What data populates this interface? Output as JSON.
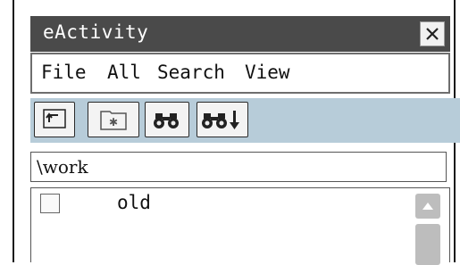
{
  "window": {
    "title": "eActivity"
  },
  "menu": {
    "items": [
      {
        "label": "File"
      },
      {
        "label": "All"
      },
      {
        "label": "Search"
      },
      {
        "label": "View"
      }
    ]
  },
  "toolbar": {
    "buttons": [
      {
        "icon": "folder-up-icon"
      },
      {
        "icon": "new-folder-icon"
      },
      {
        "icon": "binoculars-icon"
      },
      {
        "icon": "binoculars-next-icon"
      }
    ]
  },
  "path": {
    "value": "\\work"
  },
  "list": {
    "items": [
      {
        "label": "old",
        "checked": false
      }
    ]
  },
  "colors": {
    "titlebar": "#4a4a4a",
    "toolbar": "#b7ccd9",
    "scrollbar": "#bdbdbd"
  }
}
